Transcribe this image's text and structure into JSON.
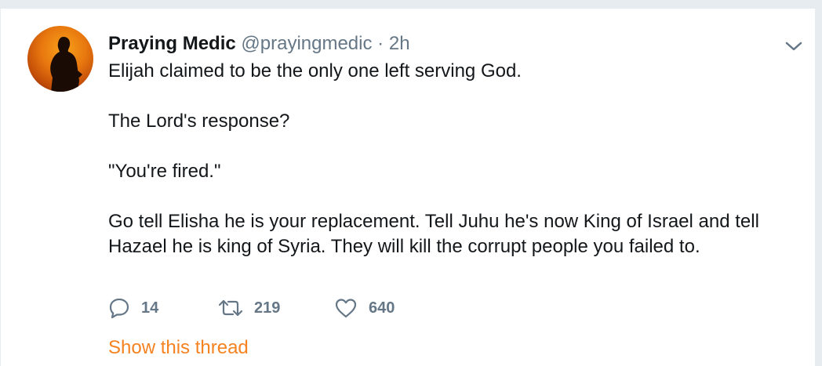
{
  "tweet": {
    "author_name": "Praying Medic",
    "author_handle": "@prayingmedic",
    "separator": "·",
    "time": "2h",
    "paragraphs": [
      "Elijah claimed to be the only one left serving God.",
      "The Lord's response?",
      "\"You're fired.\"",
      "Go tell Elisha he is your replacement. Tell Juhu he's now King of Israel and tell\nHazael he is king of Syria. They will kill the corrupt people you failed to."
    ],
    "reply_count": "14",
    "retweet_count": "219",
    "like_count": "640",
    "show_thread_label": "Show this thread"
  },
  "icons": {
    "avatar": "avatar-silhouette",
    "caret": "chevron-down-icon",
    "reply": "reply-icon",
    "retweet": "retweet-icon",
    "like": "heart-icon"
  },
  "colors": {
    "accent": "#f5821f",
    "text": "#14171a",
    "muted": "#657786",
    "background": "#e6ecf0",
    "card": "#ffffff"
  }
}
